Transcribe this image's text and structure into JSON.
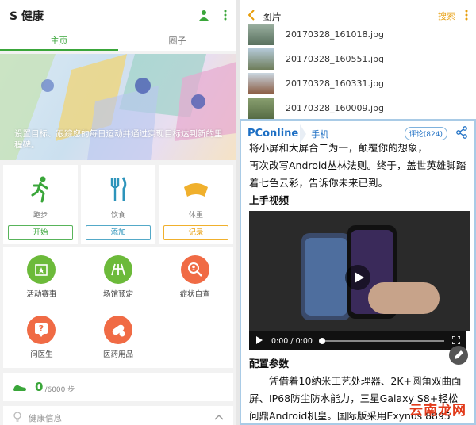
{
  "left": {
    "app_title": "S 健康",
    "tabs": [
      {
        "label": "主页",
        "active": true
      },
      {
        "label": "圈子",
        "active": false
      }
    ],
    "banner_text": "设置目标、跟踪您的每日运动并通过实现目标达到新的里程碑。",
    "trackers": [
      {
        "label": "跑步",
        "button": "开始",
        "icon": "running-icon"
      },
      {
        "label": "饮食",
        "button": "添加",
        "icon": "fork-knife-icon"
      },
      {
        "label": "体重",
        "button": "记录",
        "icon": "scale-icon"
      }
    ],
    "services": [
      {
        "label": "活动赛事",
        "icon": "calendar-star-icon",
        "color": "#6cba3a"
      },
      {
        "label": "场馆预定",
        "icon": "track-icon",
        "color": "#6cba3a"
      },
      {
        "label": "症状自查",
        "icon": "magnifier-person-icon",
        "color": "#f06b45"
      },
      {
        "label": "问医生",
        "icon": "question-bubble-icon",
        "color": "#f06b45"
      },
      {
        "label": "医药用品",
        "icon": "pill-icon",
        "color": "#f06b45"
      }
    ],
    "steps": {
      "count": "0",
      "goal": "/6000 步"
    },
    "health_info": "健康信息"
  },
  "right": {
    "gallery_title": "图片",
    "search_label": "搜索",
    "files": [
      "20170328_161018.jpg",
      "20170328_160551.jpg",
      "20170328_160331.jpg",
      "20170328_160009.jpg"
    ],
    "logo": "PConline",
    "channel": "手机",
    "comments": "评论(824)",
    "para1_partial": "将小屏和大屏合二为一，颠覆你的想象，",
    "para1": "再次改写Android丛林法则。终于，盖世英雄脚踏着七色云彩，告诉你未来已到。",
    "heading_video": "上手视频",
    "video_time": "0:00 / 0:00",
    "heading_config": "配置参数",
    "para2": "凭借着10纳米工艺处理器、2K+圆角双曲面屏、IP68防尘防水能力，三星Galaxy S8+轻松问鼎Android机皇。国际版采用Exynos 8895",
    "watermark": "云南龙网"
  }
}
